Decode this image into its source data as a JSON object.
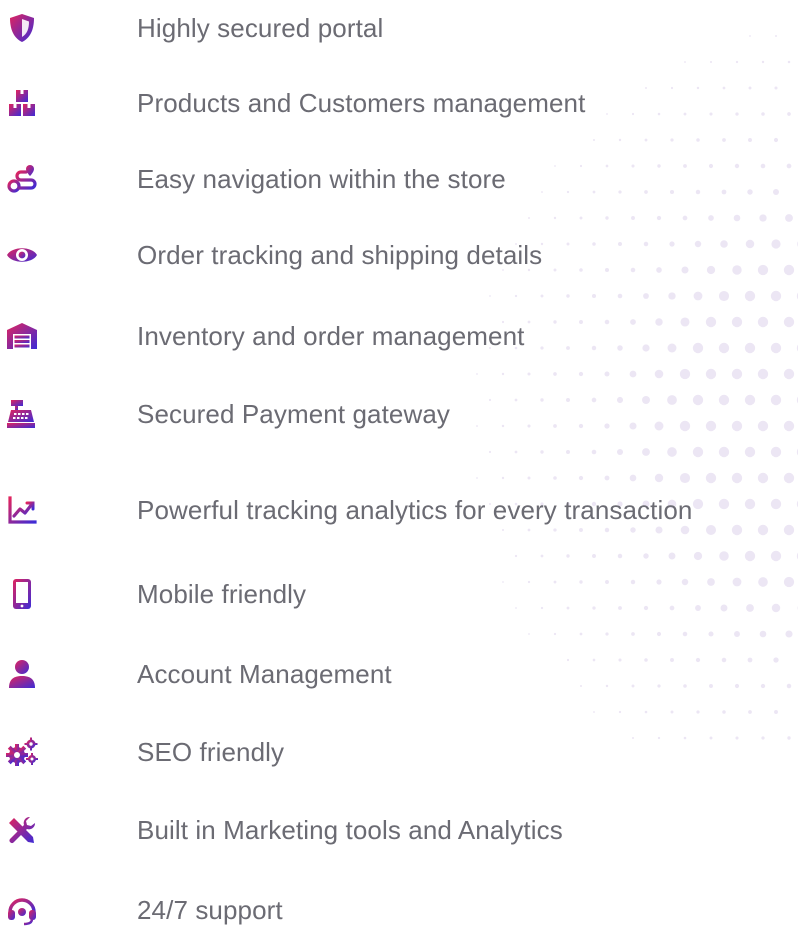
{
  "colors": {
    "icon_gradient_start": "#e0245e",
    "icon_gradient_end": "#3d2bd6",
    "label_text": "#6b6b73",
    "background_dots": "#ece6f4"
  },
  "features": [
    {
      "label": "Highly secured portal",
      "icon": "shield-icon"
    },
    {
      "label": "Products and Customers management",
      "icon": "boxes-icon"
    },
    {
      "label": "Easy navigation within the store",
      "icon": "route-icon"
    },
    {
      "label": "Order tracking and shipping details",
      "icon": "eye-icon"
    },
    {
      "label": "Inventory and order management",
      "icon": "warehouse-icon"
    },
    {
      "label": "Secured Payment gateway",
      "icon": "cash-register-icon"
    },
    {
      "label": "Powerful tracking analytics for every transaction",
      "icon": "chart-line-icon"
    },
    {
      "label": "Mobile friendly",
      "icon": "mobile-icon"
    },
    {
      "label": "Account Management",
      "icon": "user-icon"
    },
    {
      "label": "SEO friendly",
      "icon": "cogs-icon"
    },
    {
      "label": "Built in Marketing tools and Analytics",
      "icon": "tools-icon"
    },
    {
      "label": "24/7 support",
      "icon": "headset-icon"
    }
  ]
}
